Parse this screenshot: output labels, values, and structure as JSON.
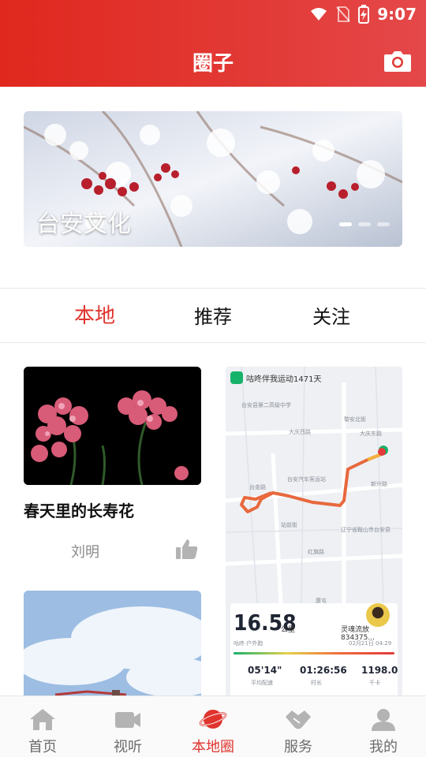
{
  "status_bar": {
    "time": "9:07"
  },
  "header": {
    "title": "圈子"
  },
  "banner": {
    "caption": "台安文化",
    "slide_count": 3,
    "active_slide": 1
  },
  "tabs": [
    {
      "label": "本地",
      "active": true
    },
    {
      "label": "推荐",
      "active": false
    },
    {
      "label": "关注",
      "active": false
    }
  ],
  "posts": {
    "left": {
      "title": "春天里的长寿花",
      "author": "刘明"
    },
    "right": {
      "app_line": "咕咚伴我运动1471天",
      "map_labels": [
        "台安县第二高级中学",
        "大庆西路",
        "大庆东路",
        "黎安北街",
        "台金路",
        "台安汽车客运站",
        "新兴路",
        "站前街",
        "辽宁省鞍山市台安县",
        "红旗路",
        "康屯"
      ],
      "distance": "16.58",
      "distance_unit": "公里",
      "activity_type": "咕咚·户外跑",
      "user": "灵魂流放834375...",
      "date": "02月21日 04:29",
      "pace": "05'14\"",
      "pace_label": "平均配速",
      "duration": "01:26:56",
      "duration_label": "时长",
      "calories": "1198.0",
      "calories_label": "千卡"
    }
  },
  "bottom_nav": [
    {
      "label": "首页",
      "icon": "home-icon",
      "active": false
    },
    {
      "label": "视听",
      "icon": "video-icon",
      "active": false
    },
    {
      "label": "本地圈",
      "icon": "planet-icon",
      "active": true
    },
    {
      "label": "服务",
      "icon": "handshake-icon",
      "active": false
    },
    {
      "label": "我的",
      "icon": "user-icon",
      "active": false
    }
  ],
  "colors": {
    "accent": "#e0342f",
    "header": "#e0281e"
  }
}
